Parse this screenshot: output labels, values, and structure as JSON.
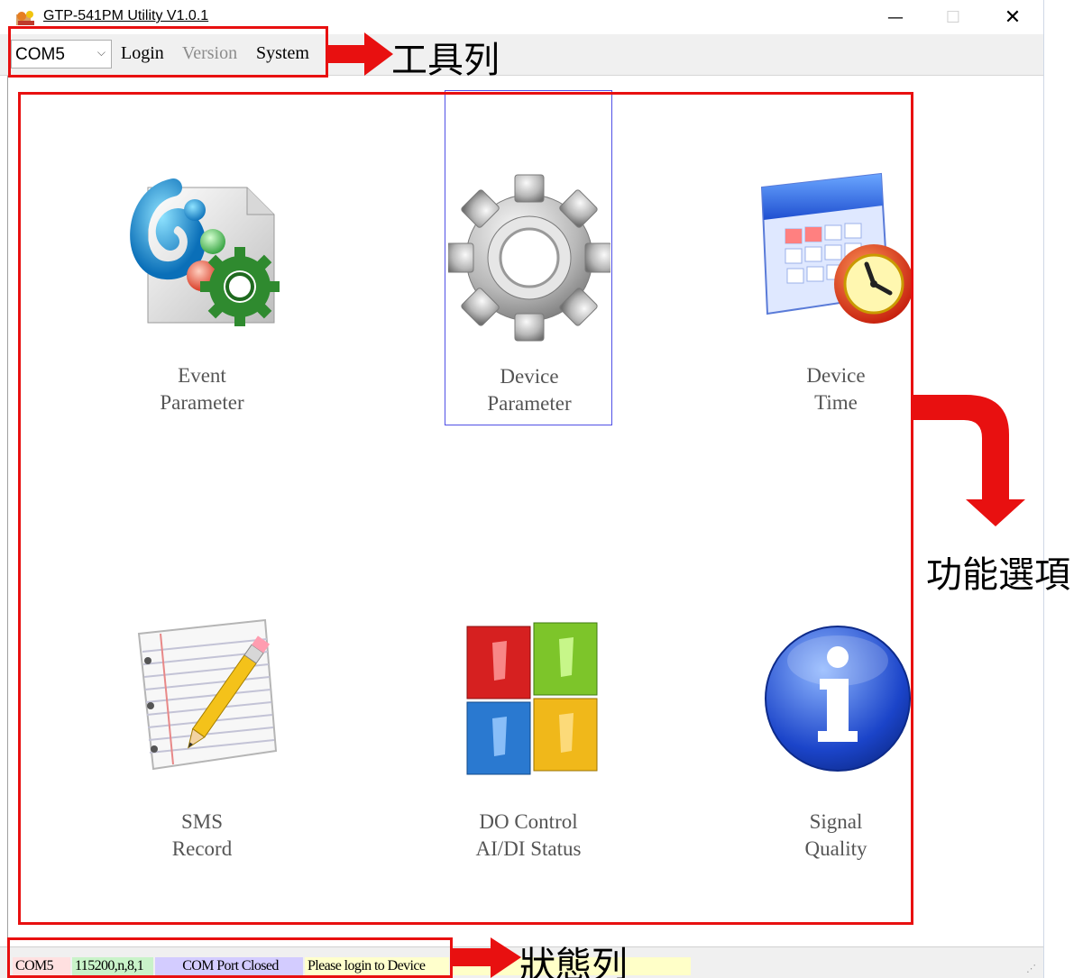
{
  "window": {
    "title": "GTP-541PM Utility V1.0.1",
    "minimize_glyph": "—",
    "maximize_glyph": "☐",
    "close_glyph": "✕"
  },
  "toolbar": {
    "com_port": "COM5",
    "menu": {
      "login": "Login",
      "version": "Version",
      "system": "System"
    }
  },
  "main": {
    "tiles": [
      {
        "line1": "Event",
        "line2": "Parameter",
        "icon": "event-parameter-icon"
      },
      {
        "line1": "Device",
        "line2": "Parameter",
        "icon": "gear-icon",
        "selected": true
      },
      {
        "line1": "Device",
        "line2": "Time",
        "icon": "calendar-clock-icon"
      },
      {
        "line1": "SMS",
        "line2": "Record",
        "icon": "notepad-pencil-icon"
      },
      {
        "line1": "DO Control",
        "line2": "AI/DI Status",
        "icon": "switches-icon"
      },
      {
        "line1": "Signal",
        "line2": "Quality",
        "icon": "info-icon"
      }
    ]
  },
  "statusbar": {
    "com": "COM5",
    "baud": "115200,n,8,1",
    "port_status": "COM Port Closed",
    "message": "Please login to Device"
  },
  "annotations": {
    "toolbar_label": "工具列",
    "content_label": "功能選項",
    "status_label": "狀態列",
    "color": "#e81010"
  },
  "colors": {
    "selection_border": "#5050e6",
    "status_com_bg": "#ffe0e0",
    "status_baud_bg": "#c9f3c9",
    "status_port_bg": "#d3ccff",
    "status_msg_bg": "#ffffcc"
  }
}
